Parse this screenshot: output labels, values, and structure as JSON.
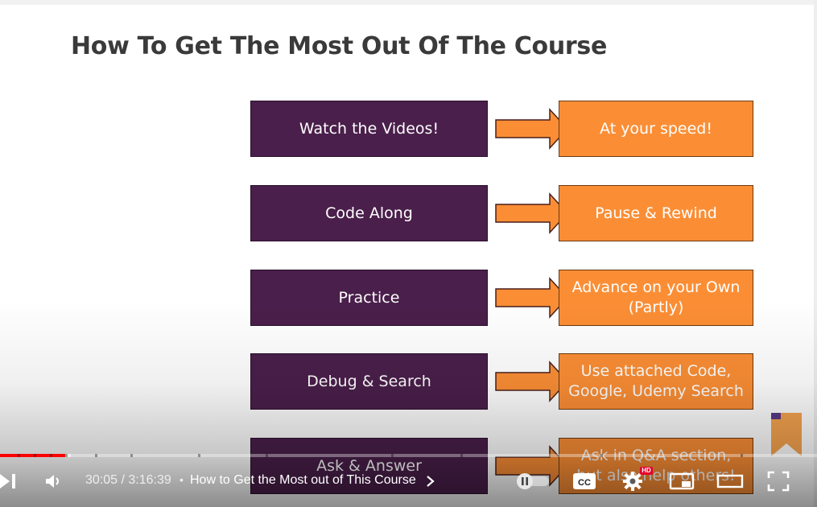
{
  "slide": {
    "title": "How To Get The Most Out Of The Course",
    "rows": [
      {
        "left": "Watch the Videos!",
        "right": "At your speed!"
      },
      {
        "left": "Code Along",
        "right": "Pause & Rewind"
      },
      {
        "left": "Practice",
        "right": "Advance on your Own\n(Partly)"
      },
      {
        "left": "Debug & Search",
        "right": "Use attached Code,\nGoogle, Udemy Search"
      },
      {
        "left": "Ask & Answer",
        "right": "Ask in Q&A section,\nbut also help others!"
      }
    ]
  },
  "player": {
    "time_current": "30:05",
    "time_total": "3:16:39",
    "time_display": "30:05 / 3:16:39",
    "separator": "•",
    "chapter_title": "How to Get the Most out of This Course",
    "progress_played_fraction": 0.08,
    "progress_buffered_fraction": 0.087,
    "hd_badge": "HD",
    "icons": {
      "next": "next-icon",
      "volume": "volume-icon",
      "chapter_arrow": "chevron-right-icon",
      "autoplay": "autoplay-toggle-icon",
      "captions": "cc-icon",
      "settings": "gear-icon",
      "miniplayer": "miniplayer-icon",
      "theater": "theater-mode-icon",
      "fullscreen": "fullscreen-icon"
    }
  },
  "colors": {
    "left_box": "#4a1f4b",
    "right_box": "#fb8e35",
    "title": "#3a3a3a",
    "progress": "#ff0000"
  }
}
